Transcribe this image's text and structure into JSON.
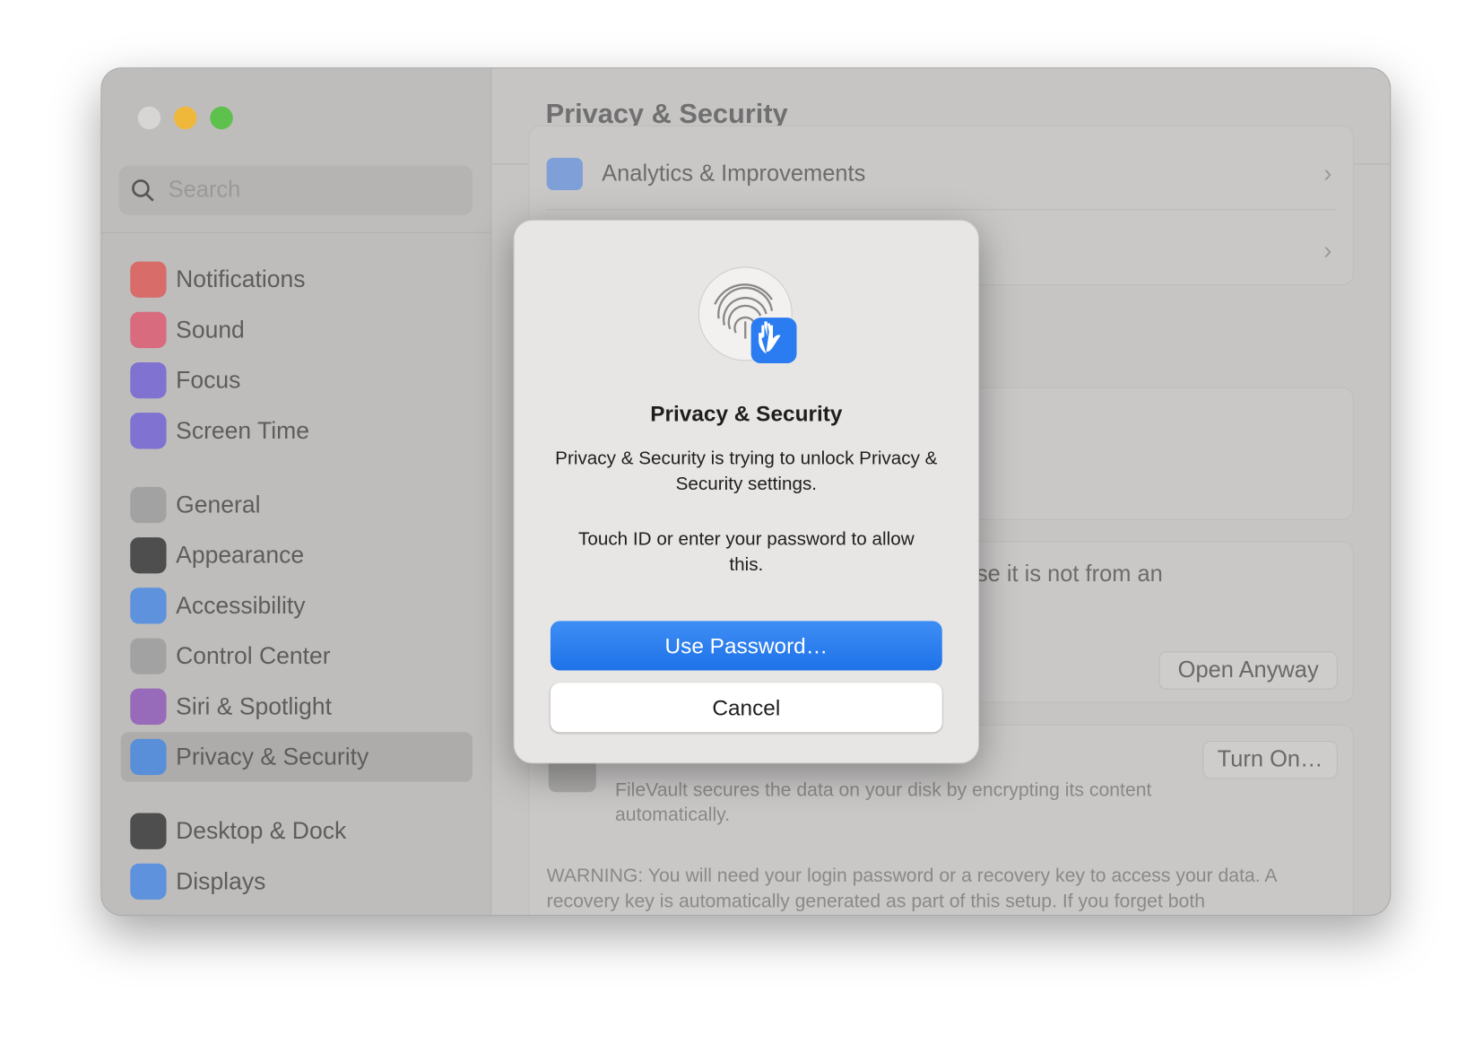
{
  "window": {
    "controls": [
      "close",
      "minimize",
      "zoom"
    ],
    "colors": {
      "close": "#d8d6d5",
      "minimize": "#f0b83a",
      "zoom": "#5ec04d"
    }
  },
  "sidebar": {
    "search_placeholder": "Search",
    "items": [
      {
        "label": "Notifications",
        "icon": "bell-icon",
        "color": "#e0524d"
      },
      {
        "label": "Sound",
        "icon": "speaker-icon",
        "color": "#e0506a"
      },
      {
        "label": "Focus",
        "icon": "moon-icon",
        "color": "#6a5ad8"
      },
      {
        "label": "Screen Time",
        "icon": "hourglass-icon",
        "color": "#6a5ad8"
      },
      {
        "label": "General",
        "icon": "gear-icon",
        "color": "#9a9a9a"
      },
      {
        "label": "Appearance",
        "icon": "appearance-icon",
        "color": "#2a2a2a"
      },
      {
        "label": "Accessibility",
        "icon": "accessibility-icon",
        "color": "#3d84e8"
      },
      {
        "label": "Control Center",
        "icon": "toggles-icon",
        "color": "#9a9a9a"
      },
      {
        "label": "Siri & Spotlight",
        "icon": "siri-icon",
        "color": "#8a50b8"
      },
      {
        "label": "Privacy & Security",
        "icon": "hand-icon",
        "color": "#3d84e8",
        "selected": true
      },
      {
        "label": "Desktop & Dock",
        "icon": "dock-icon",
        "color": "#2a2a2a"
      },
      {
        "label": "Displays",
        "icon": "sun-icon",
        "color": "#3d84e8"
      }
    ]
  },
  "main": {
    "title": "Privacy & Security",
    "analytics_label": "Analytics & Improvements",
    "partial_text": "se it is not from an",
    "open_anyway": "Open Anyway",
    "filevault_desc": "FileVault secures the data on your disk by encrypting its content automatically.",
    "turn_on": "Turn On…",
    "warning": "WARNING: You will need your login password or a recovery key to access your data. A recovery key is automatically generated as part of this setup. If you forget both"
  },
  "dialog": {
    "title": "Privacy & Security",
    "message": "Privacy & Security is trying to unlock Privacy & Security settings.",
    "prompt": "Touch ID or enter your password to allow this.",
    "use_password": "Use Password…",
    "cancel": "Cancel",
    "accent": "#2a7cf0"
  }
}
